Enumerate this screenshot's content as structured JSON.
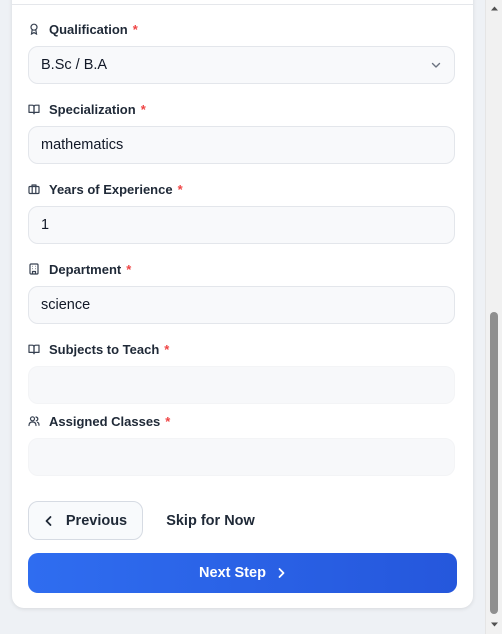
{
  "form": {
    "qualification": {
      "label": "Qualification",
      "required_mark": "*",
      "value": "B.Sc / B.A",
      "icon": "award-icon"
    },
    "specialization": {
      "label": "Specialization",
      "required_mark": "*",
      "value": "mathematics",
      "icon": "book-open-icon"
    },
    "experience": {
      "label": "Years of Experience",
      "required_mark": "*",
      "value": "1",
      "icon": "briefcase-icon"
    },
    "department": {
      "label": "Department",
      "required_mark": "*",
      "value": "science",
      "icon": "building-icon"
    },
    "subjects": {
      "label": "Subjects to Teach",
      "required_mark": "*",
      "value": "",
      "icon": "book-open-icon"
    },
    "classes": {
      "label": "Assigned Classes",
      "required_mark": "*",
      "value": "",
      "icon": "users-icon"
    }
  },
  "actions": {
    "previous_label": "Previous",
    "skip_label": "Skip for Now",
    "next_label": "Next Step"
  },
  "colors": {
    "required": "#ef4444",
    "primary": "#2563eb",
    "input_bg": "#f8f9fb"
  }
}
